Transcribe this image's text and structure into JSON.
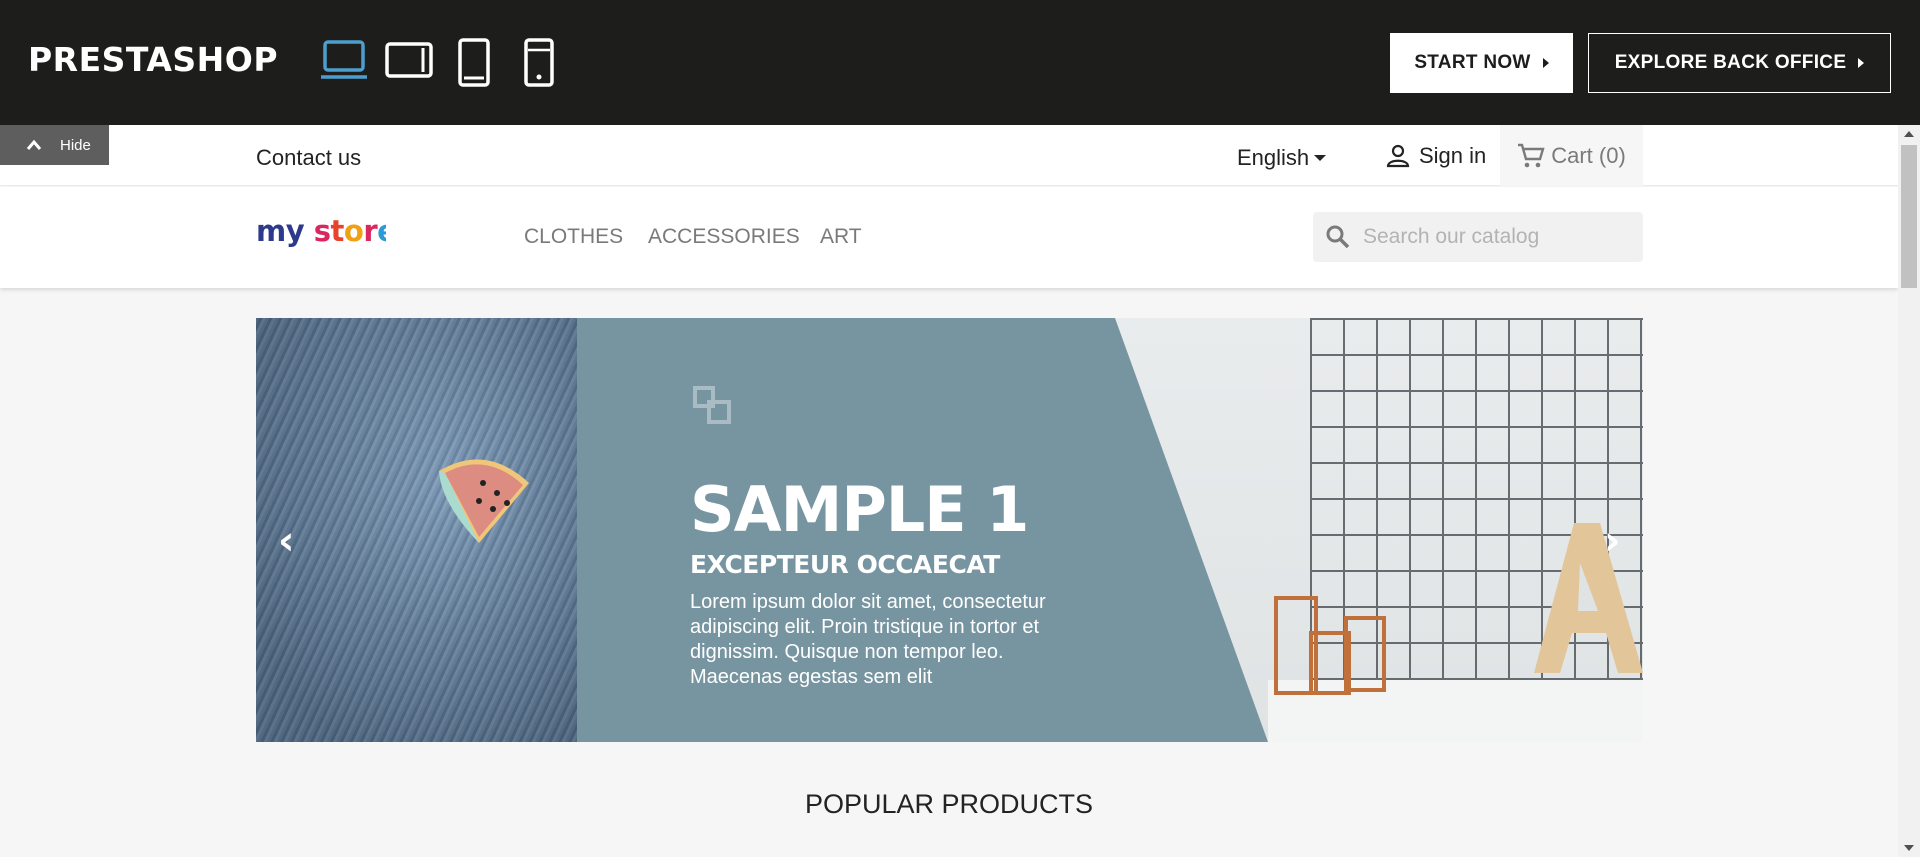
{
  "demo_bar": {
    "brand": "PRESTASHOP",
    "devices": [
      "desktop-icon",
      "tablet-landscape-icon",
      "tablet-portrait-icon",
      "mobile-icon"
    ],
    "start_label": "START NOW",
    "explore_label": "EXPLORE BACK OFFICE"
  },
  "store": {
    "hide_label": "Hide",
    "contact": "Contact us",
    "language": "English",
    "signin": "Sign in",
    "cart": "Cart (0)",
    "logo": "my store",
    "menu": [
      "CLOTHES",
      "ACCESSORIES",
      "ART"
    ],
    "search_placeholder": "Search our catalog"
  },
  "slider": {
    "title": "SAMPLE 1",
    "subtitle": "EXCEPTEUR OCCAECAT",
    "description": "Lorem ipsum dolor sit amet, consectetur adipiscing elit. Proin tristique in tortor et dignissim. Quisque non tempor leo. Maecenas egestas sem elit",
    "prev": "‹",
    "next": "›"
  },
  "section": {
    "popular": "POPULAR PRODUCTS"
  },
  "colors": {
    "bar": "#1d1d1b",
    "accent": "#4c9ecf",
    "slide": "#7795a1"
  }
}
